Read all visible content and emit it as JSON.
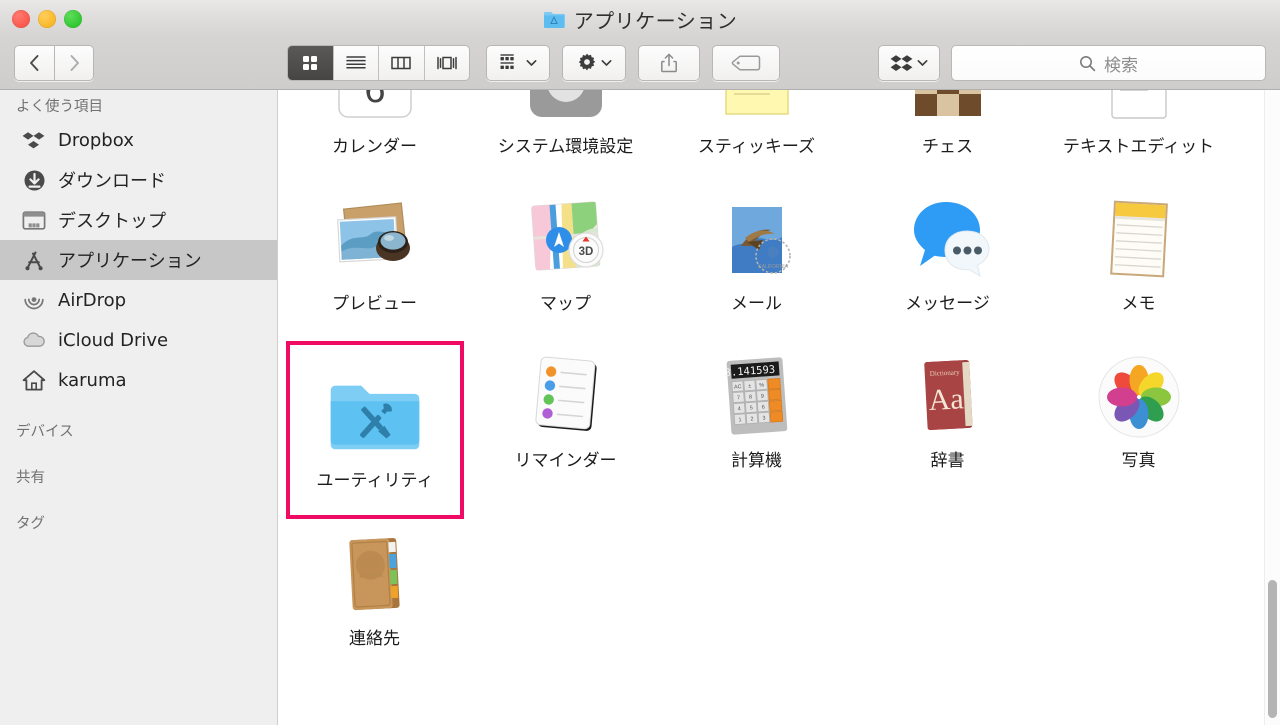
{
  "window": {
    "title": "アプリケーション",
    "title_icon": "applications-folder-icon",
    "traffic_lights": {
      "close_color": "#f9493d",
      "minimize_color": "#f6ac13",
      "maximize_color": "#1dbf1d"
    }
  },
  "toolbar": {
    "back_label": "戻る",
    "forward_label": "進む",
    "views": [
      {
        "name": "icon-view",
        "label": "アイコン表示",
        "active": true
      },
      {
        "name": "list-view",
        "label": "リスト表示",
        "active": false
      },
      {
        "name": "column-view",
        "label": "カラム表示",
        "active": false
      },
      {
        "name": "coverflow-view",
        "label": "Cover Flow表示",
        "active": false
      }
    ],
    "arrange_label": "グループ分け",
    "action_label": "操作",
    "share_label": "共有",
    "tag_label": "タグ",
    "dropbox_label": "Dropbox"
  },
  "search": {
    "placeholder": "検索",
    "value": ""
  },
  "sidebar": {
    "sections": [
      {
        "title": "よく使う項目",
        "items": [
          {
            "label": "Dropbox",
            "icon": "dropbox-icon",
            "selected": false
          },
          {
            "label": "ダウンロード",
            "icon": "downloads-icon",
            "selected": false
          },
          {
            "label": "デスクトップ",
            "icon": "desktop-icon",
            "selected": false
          },
          {
            "label": "アプリケーション",
            "icon": "applications-icon",
            "selected": true
          },
          {
            "label": "AirDrop",
            "icon": "airdrop-icon",
            "selected": false
          },
          {
            "label": "iCloud Drive",
            "icon": "icloud-icon",
            "selected": false
          },
          {
            "label": "karuma",
            "icon": "home-icon",
            "selected": false
          }
        ]
      },
      {
        "title": "デバイス",
        "items": []
      },
      {
        "title": "共有",
        "items": []
      },
      {
        "title": "タグ",
        "items": []
      }
    ]
  },
  "content": {
    "items": [
      {
        "label": "カレンダー",
        "icon": "calendar-app-icon",
        "highlighted": false
      },
      {
        "label": "システム環境設定",
        "icon": "system-preferences-app-icon",
        "highlighted": false
      },
      {
        "label": "スティッキーズ",
        "icon": "stickies-app-icon",
        "highlighted": false
      },
      {
        "label": "チェス",
        "icon": "chess-app-icon",
        "highlighted": false
      },
      {
        "label": "テキストエディット",
        "icon": "textedit-app-icon",
        "highlighted": false
      },
      {
        "label": "プレビュー",
        "icon": "preview-app-icon",
        "highlighted": false
      },
      {
        "label": "マップ",
        "icon": "maps-app-icon",
        "highlighted": false
      },
      {
        "label": "メール",
        "icon": "mail-app-icon",
        "highlighted": false
      },
      {
        "label": "メッセージ",
        "icon": "messages-app-icon",
        "highlighted": false
      },
      {
        "label": "メモ",
        "icon": "notes-app-icon",
        "highlighted": false
      },
      {
        "label": "ユーティリティ",
        "icon": "utilities-folder-icon",
        "highlighted": true
      },
      {
        "label": "リマインダー",
        "icon": "reminders-app-icon",
        "highlighted": false
      },
      {
        "label": "計算機",
        "icon": "calculator-app-icon",
        "highlighted": false
      },
      {
        "label": "辞書",
        "icon": "dictionary-app-icon",
        "highlighted": false
      },
      {
        "label": "写真",
        "icon": "photos-app-icon",
        "highlighted": false
      },
      {
        "label": "連絡先",
        "icon": "contacts-app-icon",
        "highlighted": false
      }
    ],
    "calculator_display": "3.141593",
    "dictionary_cover_title": "Dictionary",
    "dictionary_cover_letters": "Aa",
    "maps_mode_label": "3D",
    "highlight_color": "#ef0a63"
  },
  "scrollbar": {
    "orientation": "vertical",
    "thumb_position_percent": 78
  }
}
